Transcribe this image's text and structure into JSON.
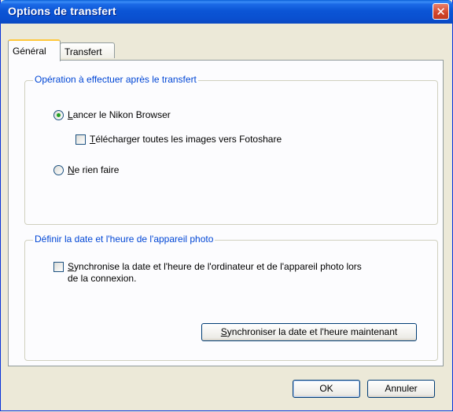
{
  "window": {
    "title": "Options de transfert",
    "close_icon": "close-icon"
  },
  "tabs": [
    {
      "label": "Général",
      "active": true
    },
    {
      "label": "Transfert",
      "active": false
    }
  ],
  "group_after_transfer": {
    "legend": "Opération à effectuer après le transfert",
    "launch_browser": {
      "label_ul": "L",
      "label_rest": "ancer le Nikon Browser",
      "selected": true
    },
    "upload_fotoshare": {
      "label_ul": "T",
      "label_rest": "élécharger toutes les images vers Fotoshare",
      "checked": false
    },
    "do_nothing": {
      "label_ul": "N",
      "label_rest": "e rien faire",
      "selected": false
    }
  },
  "group_datetime": {
    "legend": "Définir la date et l'heure de l'appareil photo",
    "sync_on_connect": {
      "label_ul": "S",
      "label_rest": "ynchronise la date et l'heure de l'ordinateur et de l'appareil photo lors",
      "label_line2": "de la connexion.",
      "checked": false
    },
    "sync_now_button": {
      "label_ul": "S",
      "label_rest": "ynchroniser la date et l'heure maintenant"
    }
  },
  "footer": {
    "ok_label": "OK",
    "cancel_label": "Annuler"
  }
}
